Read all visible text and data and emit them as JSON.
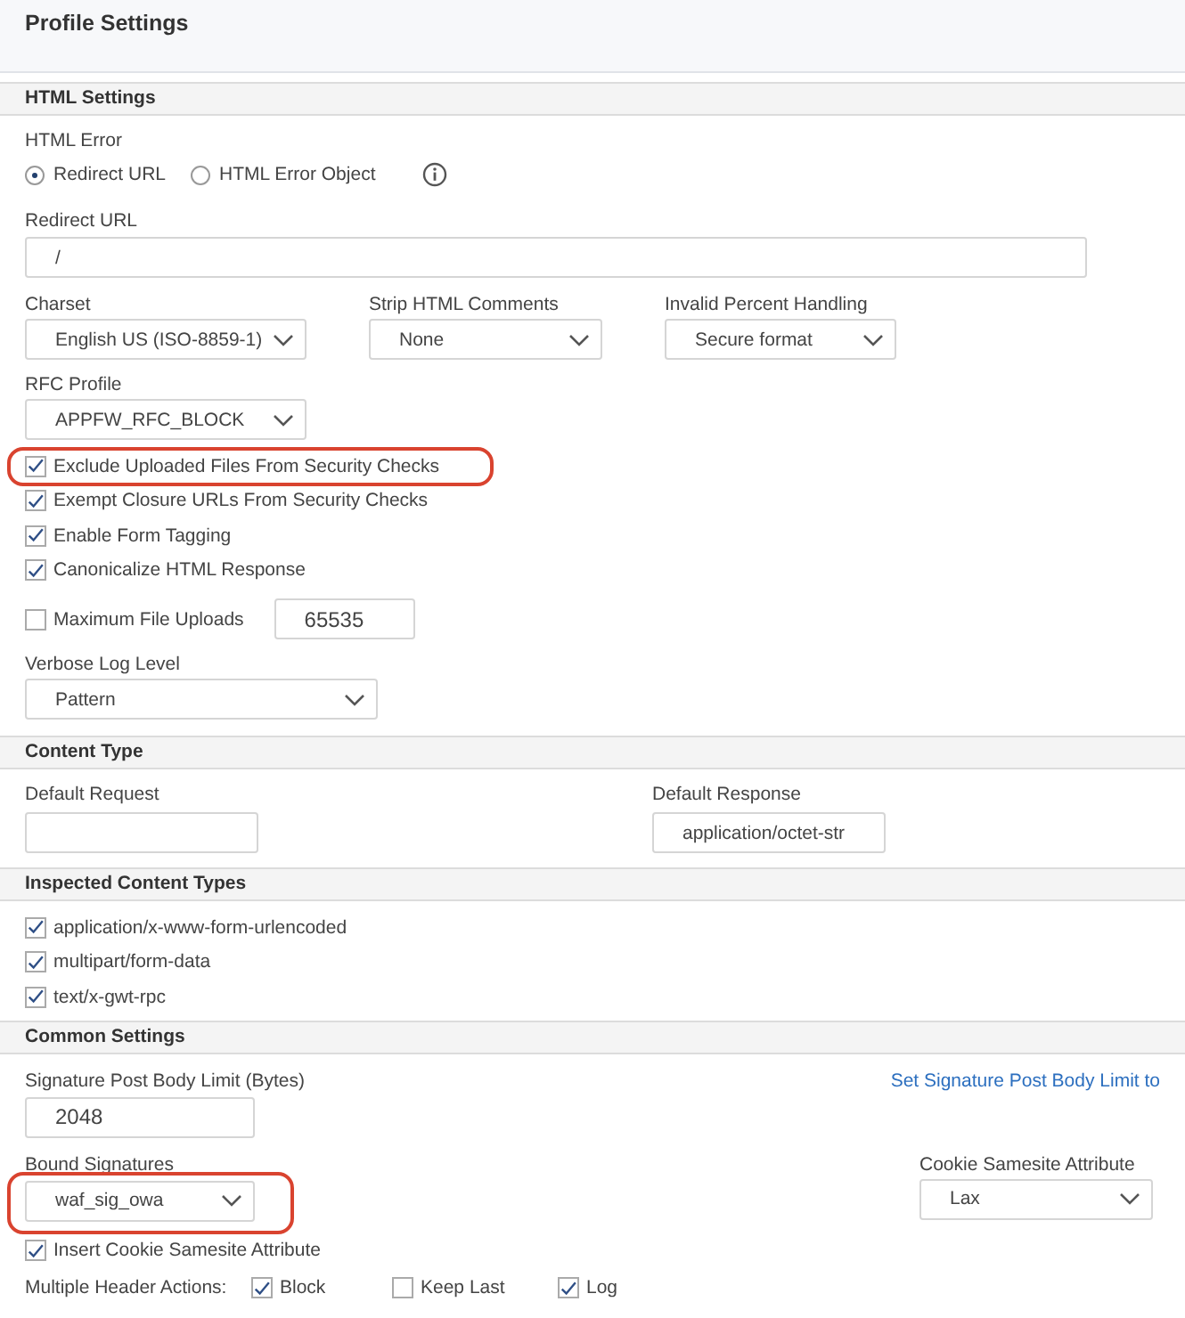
{
  "page_title": "Profile Settings",
  "html_settings": {
    "title": "HTML Settings",
    "html_error": {
      "label": "HTML Error",
      "options": [
        {
          "label": "Redirect URL",
          "selected": true
        },
        {
          "label": "HTML Error Object",
          "selected": false
        }
      ]
    },
    "redirect_url": {
      "label": "Redirect URL",
      "value": "/"
    },
    "charset": {
      "label": "Charset",
      "value": "English US (ISO-8859-1)"
    },
    "strip_html_comments": {
      "label": "Strip HTML Comments",
      "value": "None"
    },
    "invalid_percent_handling": {
      "label": "Invalid Percent Handling",
      "value": "Secure format"
    },
    "rfc_profile": {
      "label": "RFC Profile",
      "value": "APPFW_RFC_BLOCK"
    },
    "options": [
      {
        "label": "Exclude Uploaded Files From Security Checks",
        "checked": true,
        "highlighted": true
      },
      {
        "label": "Exempt Closure URLs From Security Checks",
        "checked": true,
        "highlighted": false
      },
      {
        "label": "Enable Form Tagging",
        "checked": true,
        "highlighted": false
      },
      {
        "label": "Canonicalize HTML Response",
        "checked": true,
        "highlighted": false
      }
    ],
    "max_file_uploads": {
      "label": "Maximum File Uploads",
      "checked": false,
      "value": "65535"
    },
    "verbose_log_level": {
      "label": "Verbose Log Level",
      "value": "Pattern"
    }
  },
  "content_type": {
    "title": "Content Type",
    "default_request": {
      "label": "Default Request"
    },
    "default_response": {
      "label": "Default Response",
      "value": "application/octet-str"
    }
  },
  "inspected_content_types": {
    "title": "Inspected Content Types",
    "items": [
      {
        "label": "application/x-www-form-urlencoded",
        "checked": true
      },
      {
        "label": "multipart/form-data",
        "checked": true
      },
      {
        "label": "text/x-gwt-rpc",
        "checked": true
      }
    ]
  },
  "common_settings": {
    "title": "Common Settings",
    "signature_post_body_limit": {
      "label": "Signature Post Body Limit (Bytes)",
      "value": "2048"
    },
    "link": "Set Signature Post Body Limit to",
    "bound_signatures": {
      "label": "Bound Signatures",
      "value": "waf_sig_owa",
      "highlighted": true
    },
    "cookie_samesite_attribute": {
      "label": "Cookie Samesite Attribute",
      "value": "Lax"
    },
    "insert_cookie_samesite_attribute": {
      "label": "Insert Cookie Samesite Attribute",
      "checked": true
    },
    "multiple_header_actions": {
      "label": "Multiple Header Actions:",
      "options": [
        {
          "label": "Block",
          "checked": true
        },
        {
          "label": "Keep Last",
          "checked": false
        },
        {
          "label": "Log",
          "checked": true
        }
      ]
    }
  }
}
